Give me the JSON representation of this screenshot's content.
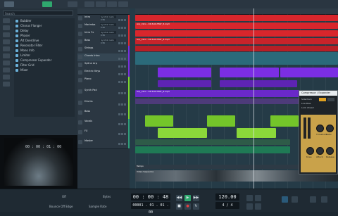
{
  "left_panel": {
    "search_placeholder": "Search",
    "files": [
      "Bubbler",
      "Chorus Flanger",
      "Delay",
      "Phaser",
      "Alt Overdrive",
      "Resonator Filter",
      "Mono Info",
      "Limiter",
      "Compressor Expander",
      "Filter Grid",
      "Mixer"
    ]
  },
  "video": {
    "timecode": "00 : 00 : 01 : 00"
  },
  "tracks": [
    {
      "name": "Intro",
      "inst": "Synth1 Cello C36",
      "color": "#e0292f"
    },
    {
      "name": "Marimba",
      "inst": "Synth1 Cello C36",
      "color": "#e0292f"
    },
    {
      "name": "Intro Fx",
      "inst": "Synth1 Cello C36",
      "color": "#e0292f"
    },
    {
      "name": "Bass",
      "inst": "Synth1 Cello C36",
      "color": "#e0292f"
    },
    {
      "name": "Strings",
      "inst": "",
      "color": "#7a2fe0"
    },
    {
      "name": "Chords Intro",
      "inst": "",
      "color": "#7a2fe0"
    },
    {
      "name": "Spline Arp",
      "inst": "",
      "color": "#7a2fe0"
    },
    {
      "name": "Electric Keys",
      "inst": "",
      "color": "#7a2fe0"
    },
    {
      "name": "Piano",
      "inst": "",
      "color": "#7dd62f"
    },
    {
      "name": "Synth Pad",
      "inst": "",
      "color": "#7dd62f"
    },
    {
      "name": "Drums",
      "inst": "",
      "color": "#7dd62f"
    },
    {
      "name": "Bass",
      "inst": "",
      "color": "#7dd62f"
    },
    {
      "name": "Vocals",
      "inst": "",
      "color": "#2fa07a"
    },
    {
      "name": "FX",
      "inst": "",
      "color": "#2fa07a"
    },
    {
      "name": "Master",
      "inst": "",
      "color": "#2fa07a"
    }
  ],
  "arrange": {
    "clip_labels": [
      "Arp_Intro - RP-3LI0-TBLT_8.mp3",
      "Arp_Intro - RP-3LI0-TBLT_8.mp3",
      "Arp_Intro - RP-3LI0-TBLT_8.mp3"
    ],
    "video_track_label": "Tempo",
    "video_clip_label": "Video Sequence"
  },
  "plugin": {
    "title": "Compressor / Expander",
    "labels": [
      "Sidechain",
      "Low Pass",
      "Look Ahead",
      "Threshold",
      "Ratio",
      "Knee",
      "Attack",
      "Release"
    ],
    "colors": {
      "face": "#c9a24a"
    }
  },
  "transport": {
    "label_left": "Off",
    "label_mid": "Bytes",
    "label_bottom_left": "Bounce Off Edge",
    "label_bottom_mid": "Sample Rate",
    "time": "00 : 00 : 48 . 397",
    "bars": "00001 . 01 . 01 . 00",
    "tempo": "120.00",
    "sig": "4 / 4",
    "buttons": [
      "◀◀",
      "▶▶",
      "■",
      "▶",
      "●",
      "↻"
    ]
  }
}
